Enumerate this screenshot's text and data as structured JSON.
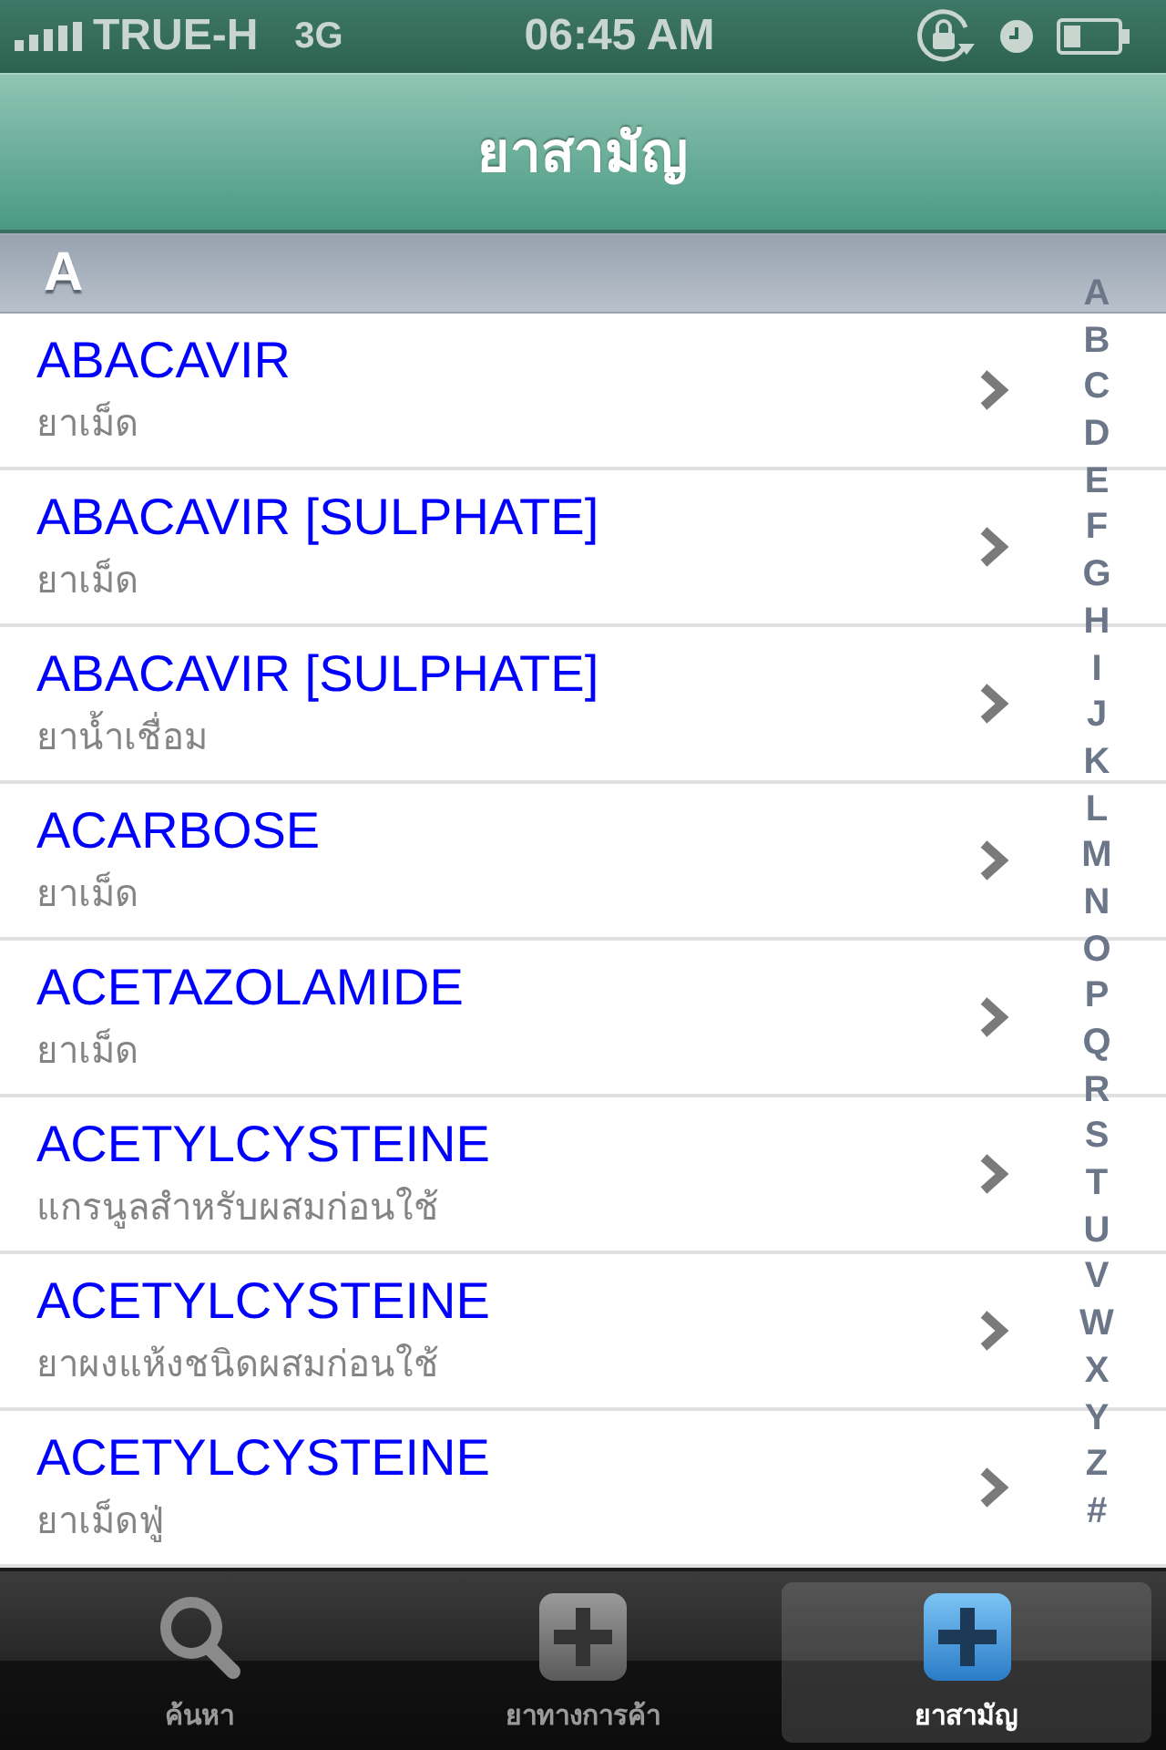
{
  "status_bar": {
    "carrier": "TRUE-H",
    "network": "3G",
    "time": "06:45 AM"
  },
  "nav_bar": {
    "title": "ยาสามัญ"
  },
  "sections": [
    {
      "header": "A",
      "rows": [
        {
          "name": "ABACAVIR",
          "form": "ยาเม็ด"
        },
        {
          "name": "ABACAVIR [SULPHATE]",
          "form": "ยาเม็ด"
        },
        {
          "name": "ABACAVIR [SULPHATE]",
          "form": "ยาน้ำเชื่อม"
        },
        {
          "name": "ACARBOSE",
          "form": "ยาเม็ด"
        },
        {
          "name": "ACETAZOLAMIDE",
          "form": "ยาเม็ด"
        },
        {
          "name": "ACETYLCYSTEINE",
          "form": "แกรนูลสำหรับผสมก่อนใช้"
        },
        {
          "name": "ACETYLCYSTEINE",
          "form": "ยาผงแห้งชนิดผสมก่อนใช้"
        },
        {
          "name": "ACETYLCYSTEINE",
          "form": "ยาเม็ดฟู่"
        }
      ]
    }
  ],
  "index": [
    "A",
    "B",
    "C",
    "D",
    "E",
    "F",
    "G",
    "H",
    "I",
    "J",
    "K",
    "L",
    "M",
    "N",
    "O",
    "P",
    "Q",
    "R",
    "S",
    "T",
    "U",
    "V",
    "W",
    "X",
    "Y",
    "Z",
    "#"
  ],
  "tab_bar": {
    "tabs": [
      {
        "label": "ค้นหา",
        "kind": "search",
        "selected": false
      },
      {
        "label": "ยาทางการค้า",
        "kind": "box",
        "selected": false
      },
      {
        "label": "ยาสามัญ",
        "kind": "box",
        "selected": true
      }
    ]
  }
}
